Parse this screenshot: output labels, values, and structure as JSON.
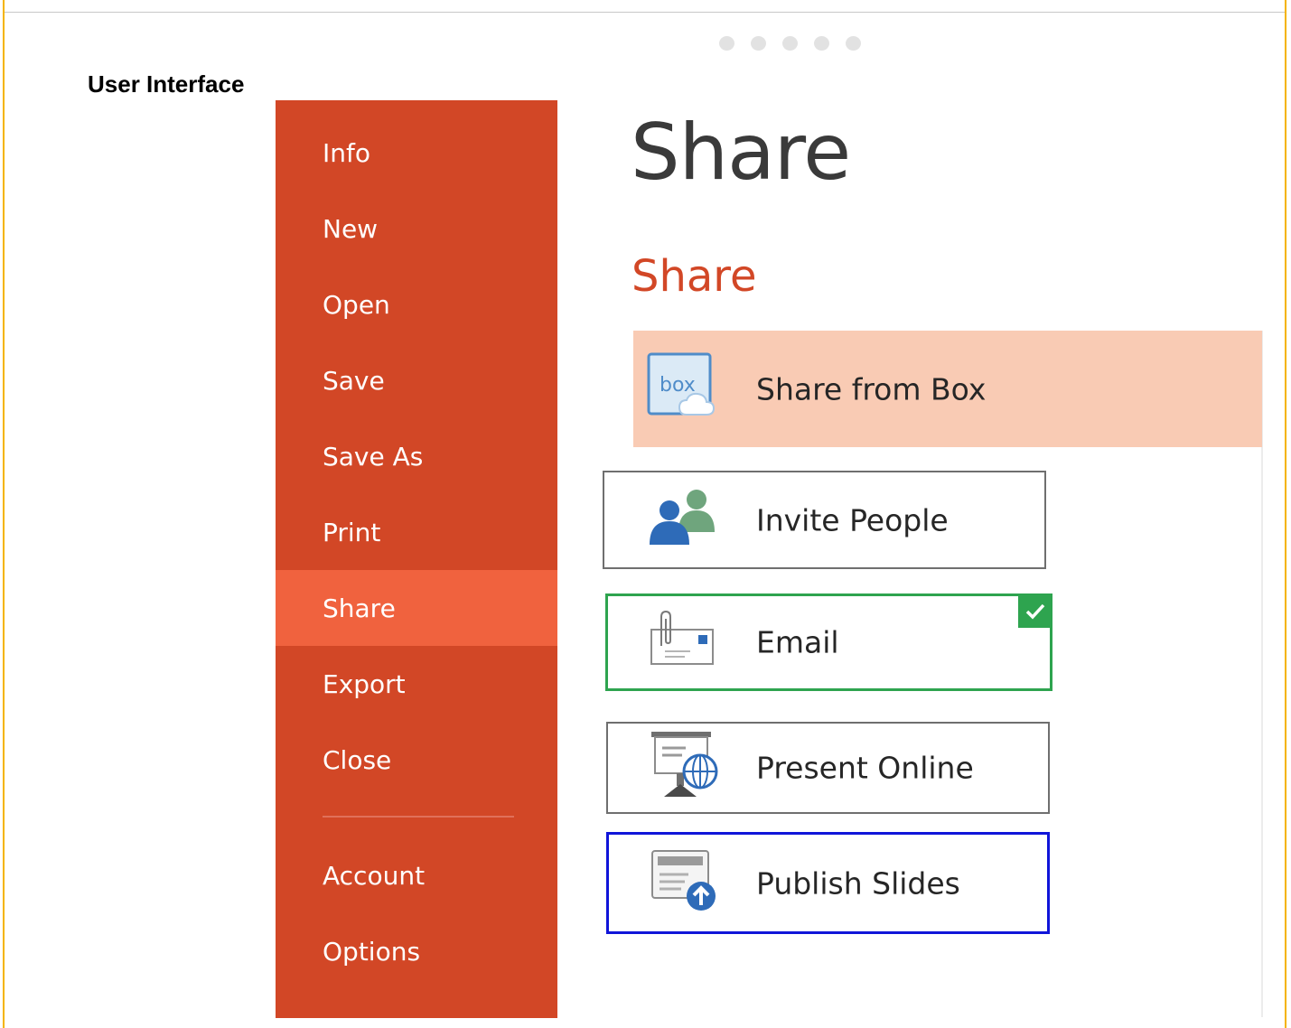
{
  "caption": "User Interface",
  "pager": {
    "dots": 5
  },
  "sidebar": {
    "items": [
      {
        "label": "Info",
        "active": false
      },
      {
        "label": "New",
        "active": false
      },
      {
        "label": "Open",
        "active": false
      },
      {
        "label": "Save",
        "active": false
      },
      {
        "label": "Save As",
        "active": false
      },
      {
        "label": "Print",
        "active": false
      },
      {
        "label": "Share",
        "active": true
      },
      {
        "label": "Export",
        "active": false
      },
      {
        "label": "Close",
        "active": false
      },
      {
        "label": "Account",
        "active": false
      },
      {
        "label": "Options",
        "active": false
      }
    ]
  },
  "main": {
    "title": "Share",
    "section_title": "Share",
    "options": [
      {
        "label": "Share from Box",
        "icon": "box-cloud-icon",
        "state": "highlighted"
      },
      {
        "label": "Invite People",
        "icon": "people-icon",
        "state": "normal"
      },
      {
        "label": "Email",
        "icon": "envelope-paperclip-icon",
        "state": "checked"
      },
      {
        "label": "Present Online",
        "icon": "presentation-globe-icon",
        "state": "normal"
      },
      {
        "label": "Publish Slides",
        "icon": "publish-slides-icon",
        "state": "selected"
      }
    ]
  },
  "colors": {
    "sidebar_bg": "#d24726",
    "sidebar_active": "#f0623e",
    "accent_text": "#d24726",
    "highlight_bg": "#f9cbb4",
    "check_green": "#2ea44f",
    "selected_blue": "#1015d9",
    "frame_border": "#f4b400"
  }
}
